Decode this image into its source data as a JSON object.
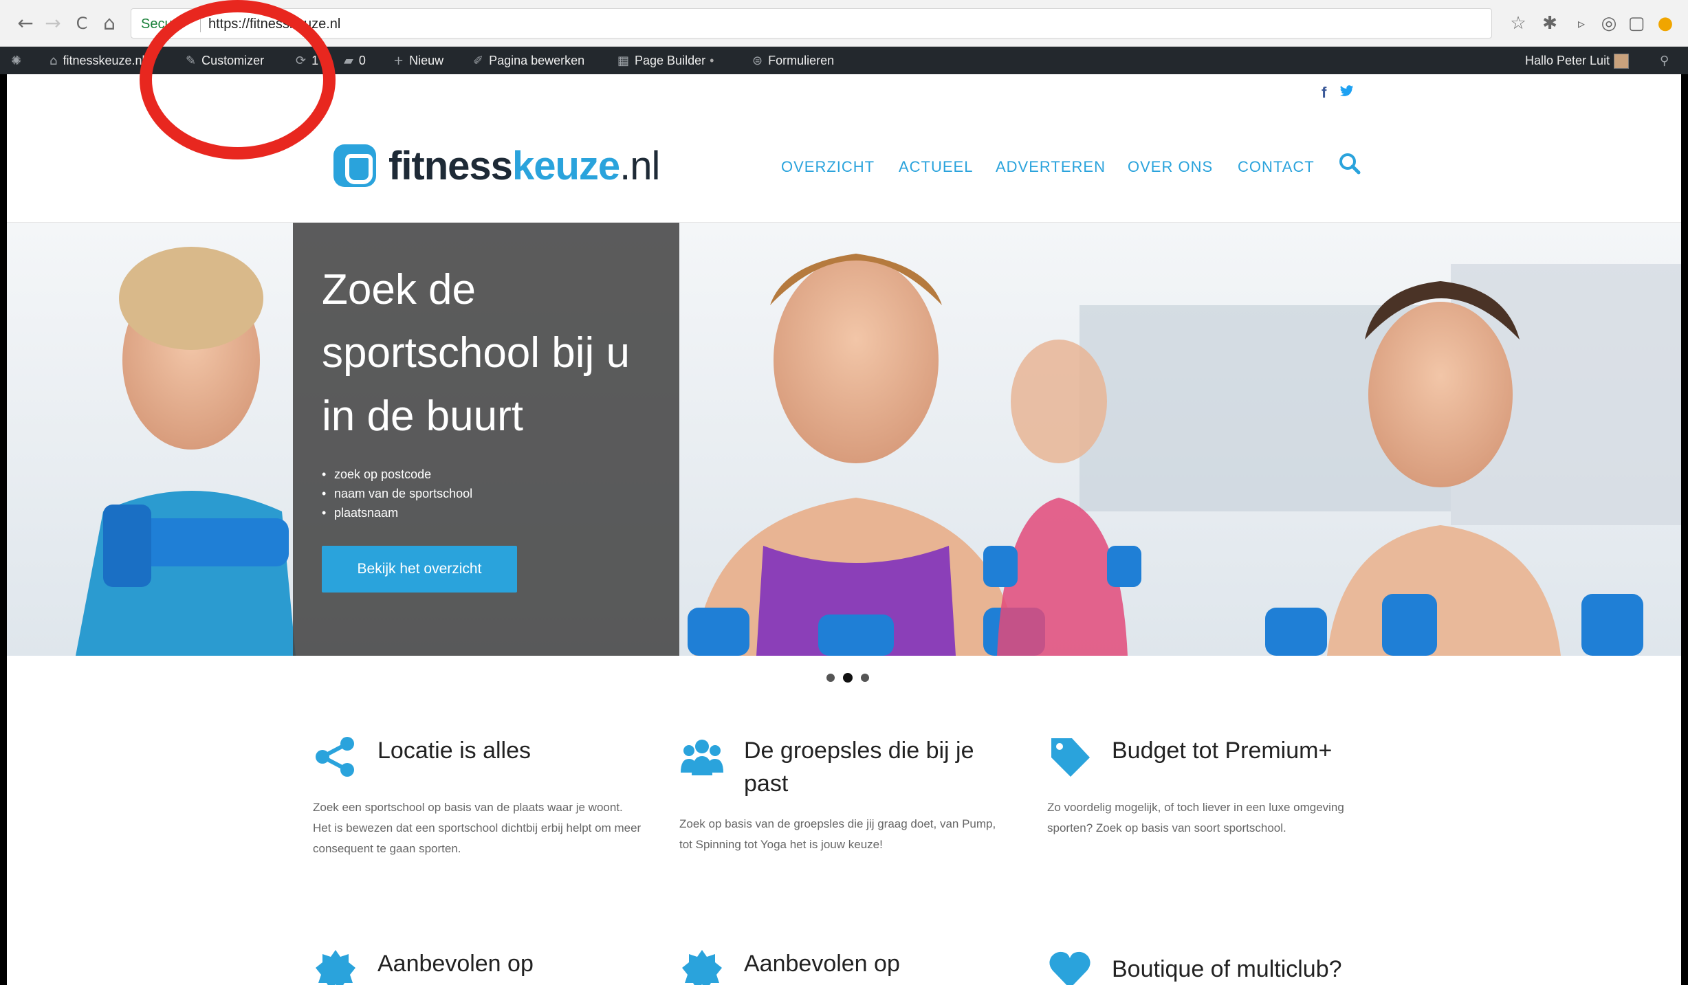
{
  "browser": {
    "back": "←",
    "forward": "→",
    "reload": "C",
    "home": "⌂",
    "secure_label": "Secure",
    "url": "https://fitnesskeuze.nl",
    "icons": [
      "star-icon",
      "extension-icon",
      "cast-icon",
      "target-icon",
      "window-icon",
      "extension-orange-icon"
    ]
  },
  "admin_bar": {
    "site_name": "fitnesskeuze.nl",
    "customizer": "Customizer",
    "updates": "1",
    "comments": "0",
    "new": "Nieuw",
    "edit_page": "Pagina bewerken",
    "page_builder": "Page Builder",
    "forms": "Formulieren",
    "greeting": "Hallo Peter Luit"
  },
  "site": {
    "social": {
      "facebook": "f",
      "twitter": "🐦"
    },
    "logo": {
      "part1": "fitness",
      "part2": "keuze",
      "part3": ".nl"
    },
    "nav": [
      "OVERZICHT",
      "ACTUEEL",
      "ADVERTEREN",
      "OVER ONS",
      "CONTACT"
    ],
    "hero": {
      "title": "Zoek de sportschool bij u in de buurt",
      "bullets": [
        "zoek op postcode",
        "naam van de sportschool",
        "plaatsnaam"
      ],
      "cta": "Bekijk het overzicht"
    },
    "slider": {
      "count": 3,
      "active": 2
    },
    "features": [
      {
        "title": "Locatie is alles",
        "text": "Zoek een sportschool op basis van de plaats waar je woont. Het is bewezen dat een sportschool dichtbij erbij helpt om meer consequent te gaan sporten."
      },
      {
        "title": "De groepsles die bij je past",
        "text": "Zoek op basis van de groepsles die jij graag doet, van Pump, tot Spinning tot Yoga het is jouw keuze!"
      },
      {
        "title": "Budget tot Premium+",
        "text": "Zo voordelig mogelijk, of toch liever in een luxe omgeving sporten? Zoek op basis van soort sportschool."
      },
      {
        "title": "Aanbevolen op"
      },
      {
        "title": "Aanbevolen op"
      },
      {
        "title": "Boutique of multiclub?"
      }
    ]
  },
  "colors": {
    "accent": "#2aa3dc",
    "admin_bar": "#23282d",
    "annotation": "#e8271f",
    "hero_panel": "#464646"
  }
}
